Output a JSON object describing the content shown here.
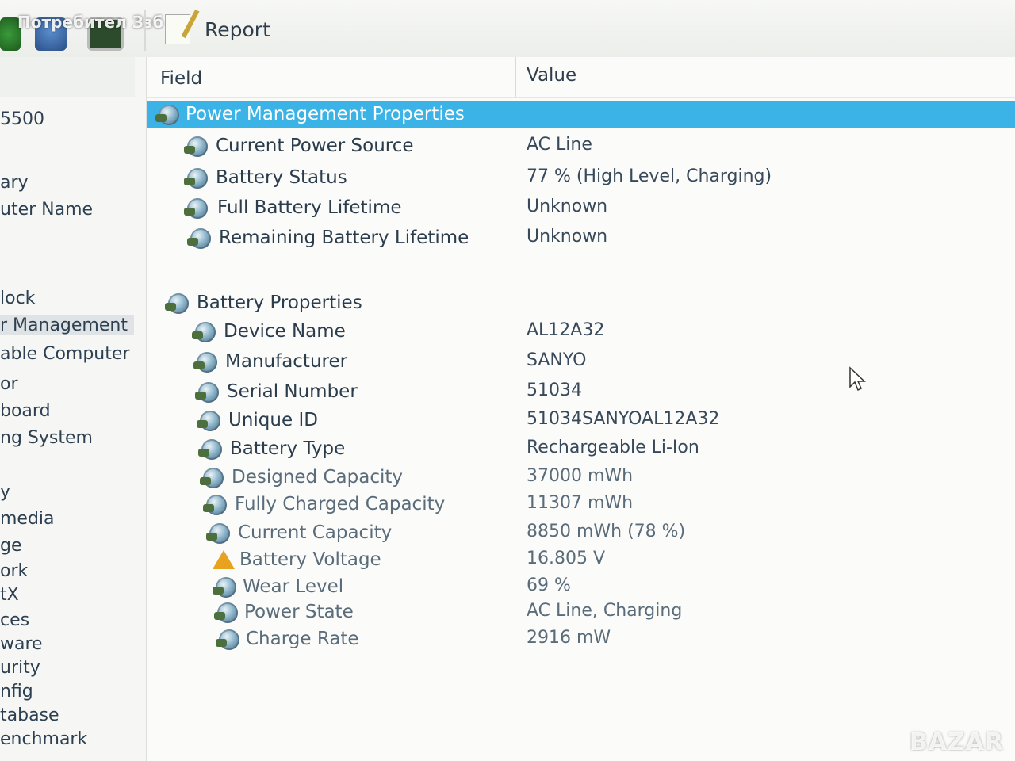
{
  "toolbar": {
    "overlay_text": "Потребител Ззб",
    "report_label": "Report"
  },
  "nav": {
    "items": [
      {
        "label": "5500",
        "selected": false
      },
      {
        "label": "ary",
        "selected": false
      },
      {
        "label": "uter Name",
        "selected": false
      },
      {
        "label": "lock",
        "selected": false
      },
      {
        "label": "r Management",
        "selected": true
      },
      {
        "label": "able Computer",
        "selected": false
      },
      {
        "label": "or",
        "selected": false
      },
      {
        "label": "board",
        "selected": false
      },
      {
        "label": "ng System",
        "selected": false
      },
      {
        "label": "y",
        "selected": false
      },
      {
        "label": "media",
        "selected": false
      },
      {
        "label": "ge",
        "selected": false
      },
      {
        "label": "ork",
        "selected": false
      },
      {
        "label": "tX",
        "selected": false
      },
      {
        "label": "ces",
        "selected": false
      },
      {
        "label": "ware",
        "selected": false
      },
      {
        "label": "urity",
        "selected": false
      },
      {
        "label": "nfig",
        "selected": false
      },
      {
        "label": "tabase",
        "selected": false
      },
      {
        "label": "enchmark",
        "selected": false
      }
    ]
  },
  "table": {
    "col_field": "Field",
    "col_value": "Value",
    "sections": [
      {
        "title": "Power Management Properties",
        "rows": [
          {
            "field": "Current Power Source",
            "value": "AC Line",
            "icon": "power-icon"
          },
          {
            "field": "Battery Status",
            "value": "77 % (High Level, Charging)",
            "icon": "power-icon"
          },
          {
            "field": "Full Battery Lifetime",
            "value": "Unknown",
            "icon": "power-icon"
          },
          {
            "field": "Remaining Battery Lifetime",
            "value": "Unknown",
            "icon": "power-icon"
          }
        ]
      },
      {
        "title": "Battery Properties",
        "rows": [
          {
            "field": "Device Name",
            "value": "AL12A32",
            "icon": "power-icon"
          },
          {
            "field": "Manufacturer",
            "value": "SANYO",
            "icon": "power-icon"
          },
          {
            "field": "Serial Number",
            "value": "51034",
            "icon": "power-icon"
          },
          {
            "field": "Unique ID",
            "value": "51034SANYOAL12A32",
            "icon": "power-icon"
          },
          {
            "field": "Battery Type",
            "value": "Rechargeable Li-Ion",
            "icon": "power-icon"
          },
          {
            "field": "Designed Capacity",
            "value": "37000 mWh",
            "icon": "power-icon"
          },
          {
            "field": "Fully Charged Capacity",
            "value": "11307 mWh",
            "icon": "power-icon"
          },
          {
            "field": "Current Capacity",
            "value": "8850 mWh  (78 %)",
            "icon": "power-icon"
          },
          {
            "field": "Battery Voltage",
            "value": "16.805 V",
            "icon": "warning-icon"
          },
          {
            "field": "Wear Level",
            "value": "69 %",
            "icon": "power-icon"
          },
          {
            "field": "Power State",
            "value": "AC Line, Charging",
            "icon": "power-icon"
          },
          {
            "field": "Charge Rate",
            "value": "2916 mW",
            "icon": "power-icon"
          }
        ]
      }
    ]
  },
  "watermark": {
    "brand": "BAZAR"
  },
  "colors": {
    "highlight": "#3cb3e6",
    "warning": "#e8a21e"
  }
}
